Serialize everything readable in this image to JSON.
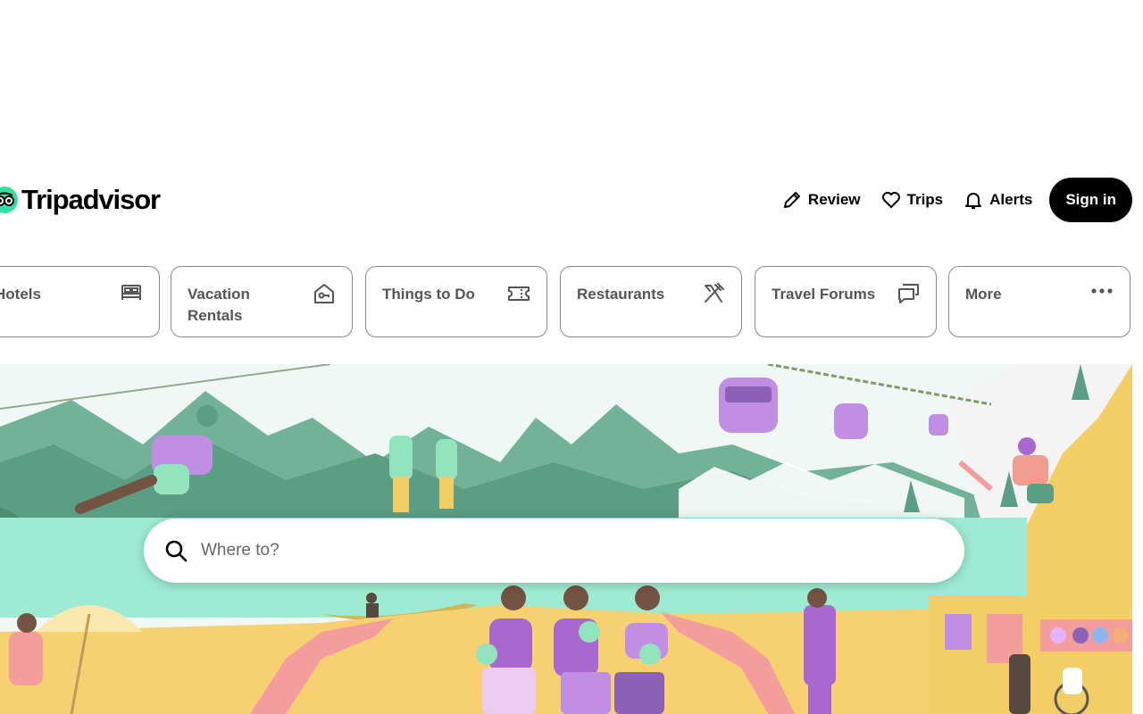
{
  "brand": {
    "name": "Tripadvisor",
    "accent": "#34e0a1"
  },
  "header": {
    "links": [
      {
        "label": "Review",
        "icon": "pencil-icon"
      },
      {
        "label": "Trips",
        "icon": "heart-icon"
      },
      {
        "label": "Alerts",
        "icon": "bell-icon"
      }
    ],
    "signin_label": "Sign in"
  },
  "tabs": [
    {
      "label": "Hotels",
      "icon": "bed-icon"
    },
    {
      "label": "Vacation Rentals",
      "icon": "house-key-icon"
    },
    {
      "label": "Things to Do",
      "icon": "ticket-icon"
    },
    {
      "label": "Restaurants",
      "icon": "fork-knife-icon"
    },
    {
      "label": "Travel Forums",
      "icon": "chat-bubbles-icon"
    },
    {
      "label": "More",
      "icon": "ellipsis-icon"
    }
  ],
  "search": {
    "placeholder": "Where to?",
    "icon": "search-icon"
  }
}
